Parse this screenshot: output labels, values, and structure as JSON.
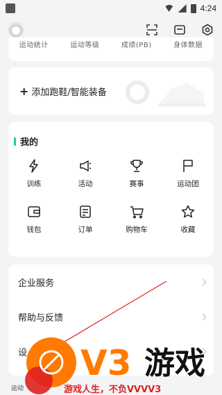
{
  "status_bar": {
    "time": "4:24"
  },
  "stats_row": [
    "运动统计",
    "运动等级",
    "成绩(PB)",
    "身体数据"
  ],
  "shoe_card": {
    "plus": "+",
    "label": "添加跑鞋/智能装备"
  },
  "mine": {
    "title": "我的",
    "items": [
      {
        "label": "训练",
        "icon": "lightning-icon"
      },
      {
        "label": "活动",
        "icon": "megaphone-icon"
      },
      {
        "label": "赛事",
        "icon": "trophy-icon"
      },
      {
        "label": "运动团",
        "icon": "flag-icon"
      },
      {
        "label": "钱包",
        "icon": "wallet-icon"
      },
      {
        "label": "订单",
        "icon": "order-icon"
      },
      {
        "label": "购物车",
        "icon": "cart-icon"
      },
      {
        "label": "收藏",
        "icon": "star-icon"
      }
    ]
  },
  "list": [
    "企业服务",
    "帮助与反馈",
    "设"
  ],
  "bottom_tab": "运动",
  "watermark": {
    "logo": "V3",
    "brand": "游戏",
    "slogan": "游戏人生，不负VVVV3"
  },
  "colors": {
    "accent": "#20c997",
    "watermark_orange": "#ff7a00",
    "watermark_red": "#e02020"
  }
}
